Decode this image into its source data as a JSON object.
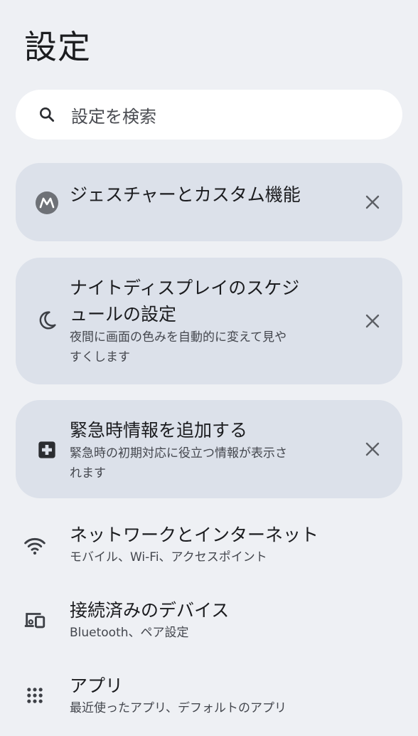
{
  "header": {
    "title": "設定"
  },
  "search": {
    "icon": "search-icon",
    "placeholder": "設定を検索"
  },
  "suggestions": [
    {
      "icon": "motorola-logo-icon",
      "title": "ジェスチャーとカスタム機能",
      "subtitle": "",
      "dismiss_icon": "close-icon"
    },
    {
      "icon": "moon-icon",
      "title_line1": "ナイトディスプレイのスケジ",
      "title_line2": "ュールの設定",
      "subtitle_line1": "夜間に画面の色みを自動的に変えて見や",
      "subtitle_line2": "すくします",
      "dismiss_icon": "close-icon"
    },
    {
      "icon": "medical-plus-icon",
      "title": "緊急時情報を追加する",
      "subtitle_line1": "緊急時の初期対応に役立つ情報が表示さ",
      "subtitle_line2": "れます",
      "dismiss_icon": "close-icon"
    }
  ],
  "settings": [
    {
      "icon": "wifi-icon",
      "title": "ネットワークとインターネット",
      "subtitle": "モバイル、Wi-Fi、アクセスポイント"
    },
    {
      "icon": "connected-devices-icon",
      "title": "接続済みのデバイス",
      "subtitle": "Bluetooth、ペア設定"
    },
    {
      "icon": "apps-grid-icon",
      "title": "アプリ",
      "subtitle": "最近使ったアプリ、デフォルトのアプリ"
    }
  ],
  "colors": {
    "background": "#eef0f4",
    "card": "#dce1ea",
    "search": "#ffffff",
    "icon": "#3d4046"
  }
}
